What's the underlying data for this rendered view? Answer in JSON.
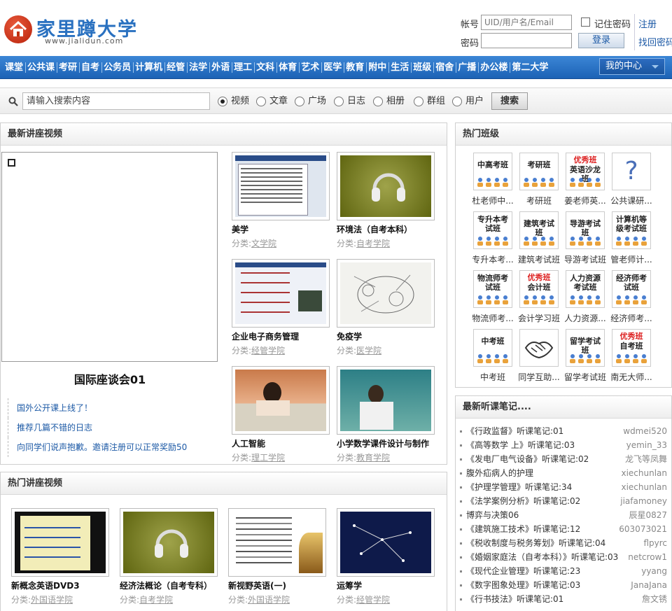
{
  "site": {
    "logo_cn": "家里蹲大学",
    "logo_en": "www.jialidun.com"
  },
  "login": {
    "account_label": "帐号",
    "account_placeholder": "UID/用户名/Email",
    "password_label": "密码",
    "remember_label": "记住密码",
    "login_button": "登录",
    "register_link": "注册",
    "forgot_link": "找回密码"
  },
  "nav": {
    "items": [
      "课堂",
      "公共课",
      "考研",
      "自考",
      "公务员",
      "计算机",
      "经管",
      "法学",
      "外语",
      "理工",
      "文科",
      "体育",
      "艺术",
      "医学",
      "教育",
      "附中",
      "生活",
      "班级",
      "宿舍",
      "广播",
      "办公楼",
      "第二大学"
    ],
    "my_center": "我的中心"
  },
  "search": {
    "placeholder": "请输入搜索内容",
    "options": [
      "视频",
      "文章",
      "广场",
      "日志",
      "相册",
      "群组",
      "用户"
    ],
    "selected": "视频",
    "button": "搜索"
  },
  "latest_videos": {
    "title": "最新讲座视频",
    "player_title": "国际座谈会01",
    "news": [
      "国外公开课上线了！",
      "推荐几篇不错的日志",
      "向同学们说声抱歉。邀请注册可以正常奖励50"
    ],
    "cat_prefix": "分类:",
    "cards": [
      {
        "title": "美学",
        "category": "文学院"
      },
      {
        "title": "环境法（自考本科）",
        "category": "自考学院"
      },
      {
        "title": "企业电子商务管理",
        "category": "经管学院"
      },
      {
        "title": "免疫学",
        "category": "医学院"
      },
      {
        "title": "人工智能",
        "category": "理工学院"
      },
      {
        "title": "小学数学课件设计与制作",
        "category": "教育学院"
      }
    ]
  },
  "hot_videos": {
    "title": "热门讲座视频",
    "cards": [
      {
        "title": "新概念英语DVD3",
        "category": "外国语学院"
      },
      {
        "title": "经济法概论（自考专科）",
        "category": "自考学院"
      },
      {
        "title": "新视野英语(一)",
        "category": "外国语学院"
      },
      {
        "title": "运筹学",
        "category": "经管学院"
      }
    ]
  },
  "hot_classes": {
    "title": "热门班级",
    "items": [
      {
        "icon_text": "中高考班",
        "badge": "",
        "name": "杜老师中..."
      },
      {
        "icon_text": "考研班",
        "badge": "",
        "name": "考研班"
      },
      {
        "icon_text": "英语沙龙班",
        "badge": "优秀班",
        "name": "姜老师英..."
      },
      {
        "icon_text": "?",
        "badge": "",
        "name": "公共课研..."
      },
      {
        "icon_text": "专升本考试班",
        "badge": "",
        "name": "专升本考..."
      },
      {
        "icon_text": "建筑考试班",
        "badge": "",
        "name": "建筑考试班"
      },
      {
        "icon_text": "导游考试班",
        "badge": "",
        "name": "导游考试班"
      },
      {
        "icon_text": "计算机等级考试班",
        "badge": "",
        "name": "管老师计..."
      },
      {
        "icon_text": "物流师考试班",
        "badge": "",
        "name": "物流师考..."
      },
      {
        "icon_text": "会计班",
        "badge": "优秀班",
        "name": "会计学习班"
      },
      {
        "icon_text": "人力资源考试班",
        "badge": "",
        "name": "人力资源..."
      },
      {
        "icon_text": "经济师考试班",
        "badge": "",
        "name": "经济师考..."
      },
      {
        "icon_text": "中考班",
        "badge": "",
        "name": "中考班"
      },
      {
        "icon_text": "handshake",
        "badge": "",
        "name": "同学互助..."
      },
      {
        "icon_text": "留学考试班",
        "badge": "",
        "name": "留学考试班"
      },
      {
        "icon_text": "自考班",
        "badge": "优秀班",
        "name": "南无大师..."
      }
    ]
  },
  "notes": {
    "title": "最新听课笔记....",
    "rows": [
      {
        "title": "《行政监督》听课笔记:01",
        "user": "wdmei520"
      },
      {
        "title": "《高等数学 上》听课笔记:03",
        "user": "yemin_33"
      },
      {
        "title": "《发电厂电气设备》听课笔记:02",
        "user": "龙飞等凤舞"
      },
      {
        "title": "腹外疝病人的护理",
        "user": "xiechunlan"
      },
      {
        "title": "《护理学管理》听课笔记:34",
        "user": "xiechunlan"
      },
      {
        "title": "《法学案例分析》听课笔记:02",
        "user": "jiafamoney"
      },
      {
        "title": "博弈与决策06",
        "user": "辰星0827"
      },
      {
        "title": "《建筑施工技术》听课笔记:12",
        "user": "603073021"
      },
      {
        "title": "《税收制度与税务筹划》听课笔记:04",
        "user": "flpyrc"
      },
      {
        "title": "《婚姻家庭法（自考本科）》听课笔记:03",
        "user": "netcrow1"
      },
      {
        "title": "《现代企业管理》听课笔记:23",
        "user": "yyang"
      },
      {
        "title": "《数字图象处理》听课笔记:03",
        "user": "JanaJana"
      },
      {
        "title": "《行书技法》听课笔记:01",
        "user": "詹文锈"
      }
    ]
  },
  "colors": {
    "brand_blue": "#2a71c0",
    "nav_blue": "#1c62b5",
    "link_blue": "#1d5aa6",
    "badge_red": "#dd2222"
  }
}
